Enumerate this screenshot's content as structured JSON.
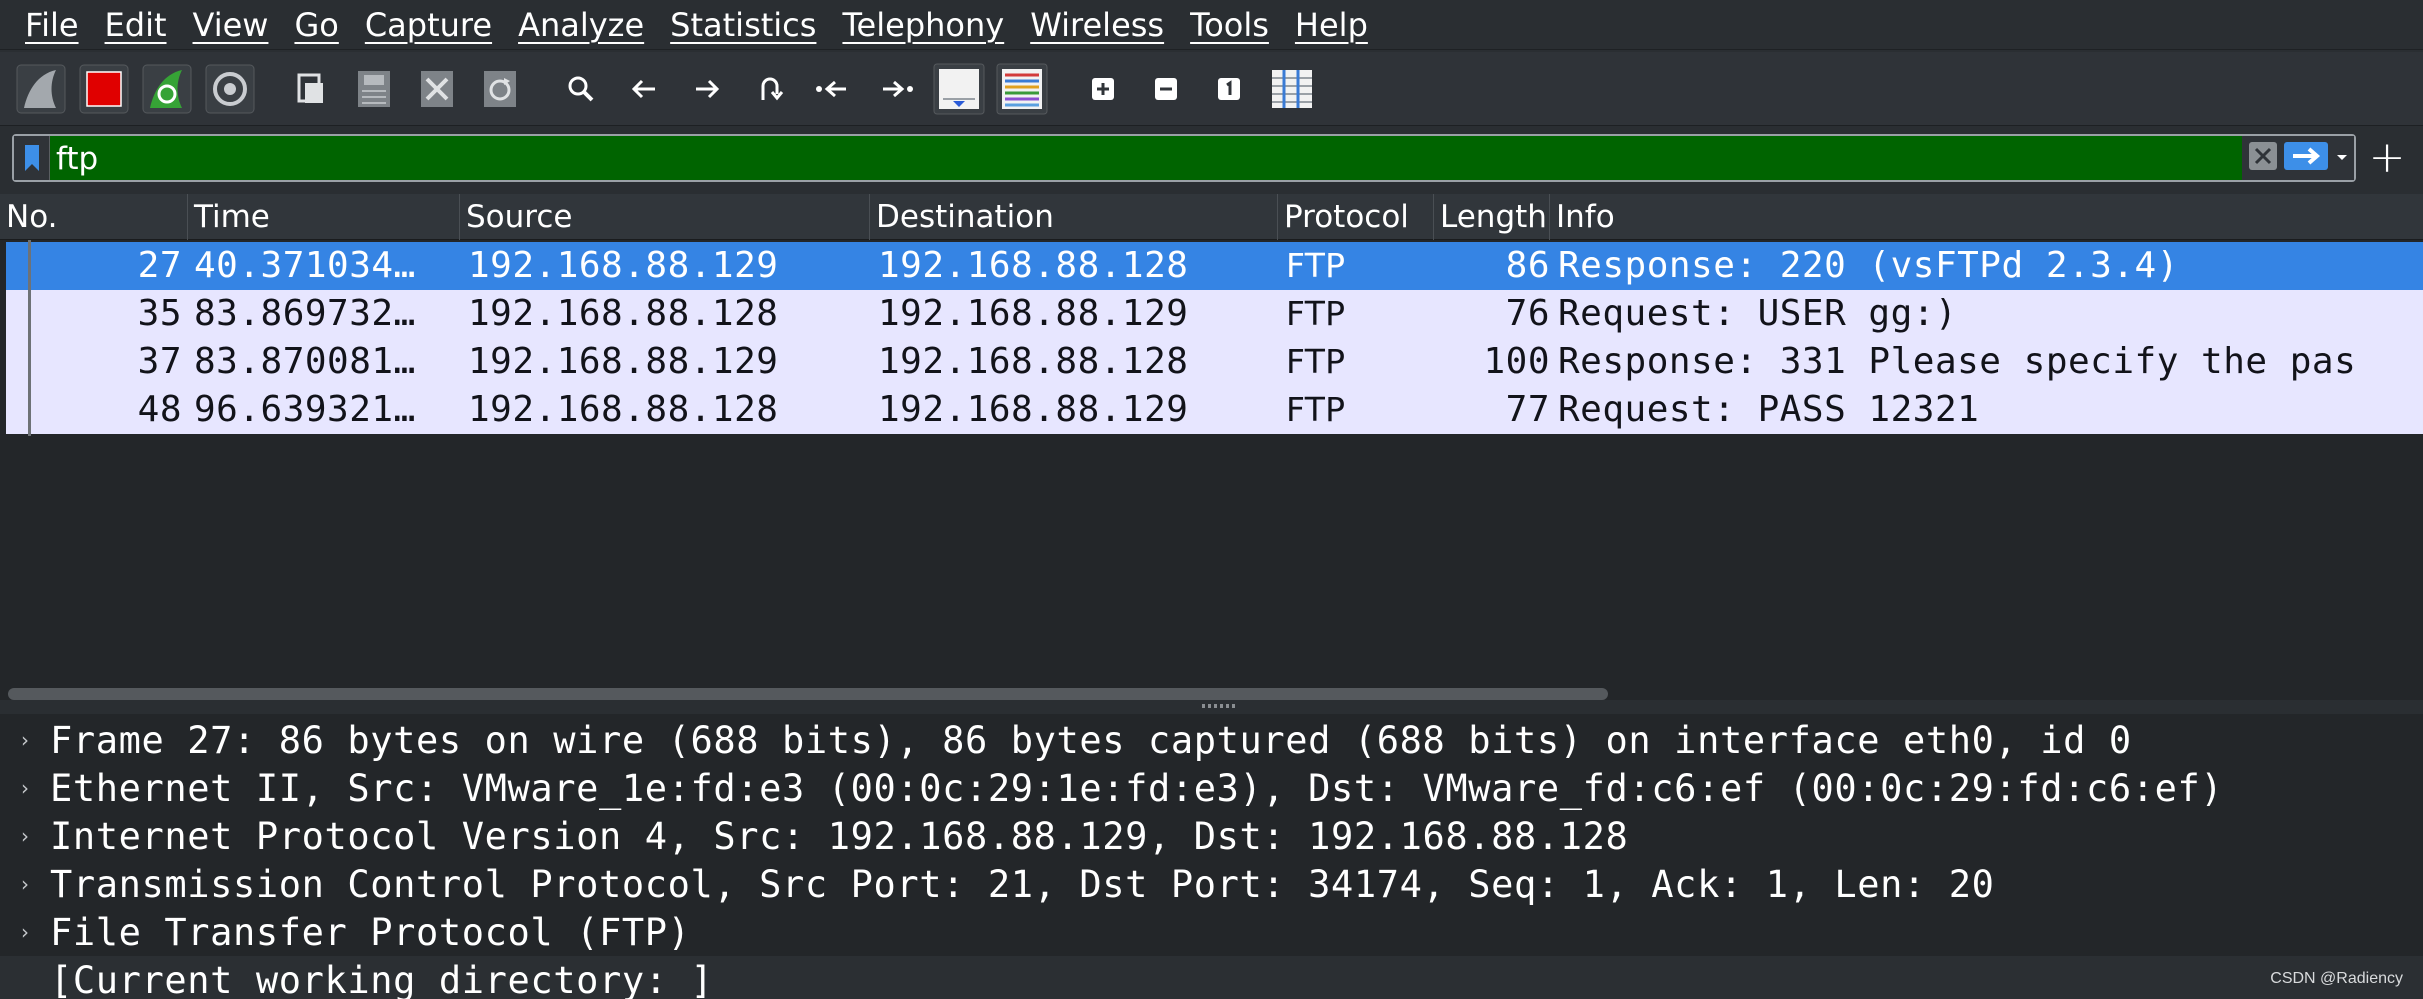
{
  "menu": [
    "File",
    "Edit",
    "View",
    "Go",
    "Capture",
    "Analyze",
    "Statistics",
    "Telephony",
    "Wireless",
    "Tools",
    "Help"
  ],
  "toolbar_icons": [
    "start-capture-icon",
    "stop-capture-icon",
    "restart-capture-icon",
    "capture-options-icon",
    "open-file-icon",
    "save-file-icon",
    "close-file-icon",
    "reload-file-icon",
    "find-packet-icon",
    "go-back-icon",
    "go-forward-icon",
    "go-to-packet-icon",
    "first-packet-icon",
    "last-packet-icon",
    "autoscroll-icon",
    "colorize-icon",
    "zoom-in-icon",
    "zoom-out-icon",
    "normal-size-icon",
    "resize-columns-icon"
  ],
  "filter": {
    "value": "ftp",
    "color": "#006400"
  },
  "columns": [
    "No.",
    "Time",
    "Source",
    "Destination",
    "Protocol",
    "Length",
    "Info"
  ],
  "packets": [
    {
      "no": "27",
      "time": "40.371034…",
      "source": "192.168.88.129",
      "destination": "192.168.88.128",
      "protocol": "FTP",
      "length": "86",
      "info": "Response: 220 (vsFTPd 2.3.4)",
      "selected": true
    },
    {
      "no": "35",
      "time": "83.869732…",
      "source": "192.168.88.128",
      "destination": "192.168.88.129",
      "protocol": "FTP",
      "length": "76",
      "info": "Request: USER gg:)",
      "selected": false
    },
    {
      "no": "37",
      "time": "83.870081…",
      "source": "192.168.88.129",
      "destination": "192.168.88.128",
      "protocol": "FTP",
      "length": "100",
      "info": "Response: 331 Please specify the pas",
      "selected": false
    },
    {
      "no": "48",
      "time": "96.639321…",
      "source": "192.168.88.128",
      "destination": "192.168.88.129",
      "protocol": "FTP",
      "length": "77",
      "info": "Request: PASS 12321",
      "selected": false
    }
  ],
  "details": [
    "Frame 27: 86 bytes on wire (688 bits), 86 bytes captured (688 bits) on interface eth0, id 0",
    "Ethernet II, Src: VMware_1e:fd:e3 (00:0c:29:1e:fd:e3), Dst: VMware_fd:c6:ef (00:0c:29:fd:c6:ef)",
    "Internet Protocol Version 4, Src: 192.168.88.129, Dst: 192.168.88.128",
    "Transmission Control Protocol, Src Port: 21, Dst Port: 34174, Seq: 1, Ack: 1, Len: 20",
    "File Transfer Protocol (FTP)",
    "[Current working directory: ]"
  ],
  "watermark": "CSDN @Radiency",
  "colors": {
    "selected_row": "#3584e4",
    "row_bg": "#e7e6ff",
    "filter_valid": "#006400"
  }
}
